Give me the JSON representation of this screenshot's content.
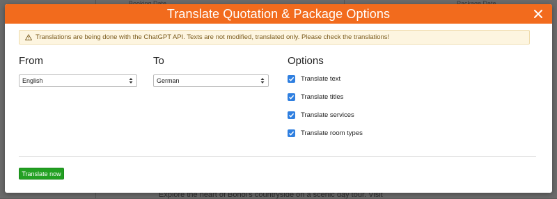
{
  "modal": {
    "title": "Translate Quotation & Package Options",
    "warning_text": "Translations are being done with the ChatGPT API. Texts are not modified, translated only. Please check the translations!",
    "from_heading": "From",
    "to_heading": "To",
    "options_heading": "Options",
    "from_value": "English",
    "to_value": "German",
    "options": [
      {
        "label": "Translate text",
        "checked": true
      },
      {
        "label": "Translate titles",
        "checked": true
      },
      {
        "label": "Translate services",
        "checked": true
      },
      {
        "label": "Translate room types",
        "checked": true
      }
    ],
    "translate_button": "Translate now"
  },
  "background": {
    "header_left": "Booking Date",
    "header_right": "Package Date",
    "bottom_text": "Explore the heart of Bohol's countryside on a scenic day tour. Visit"
  },
  "colors": {
    "header": "#f26b1d",
    "checkbox": "#2f7fe0",
    "primary_button": "#22a022",
    "warning_bg": "#fdf5e0"
  },
  "icons": {
    "close": "close-icon",
    "warning": "warning-icon",
    "check": "check-icon",
    "select_arrows": "select-arrows-icon"
  }
}
